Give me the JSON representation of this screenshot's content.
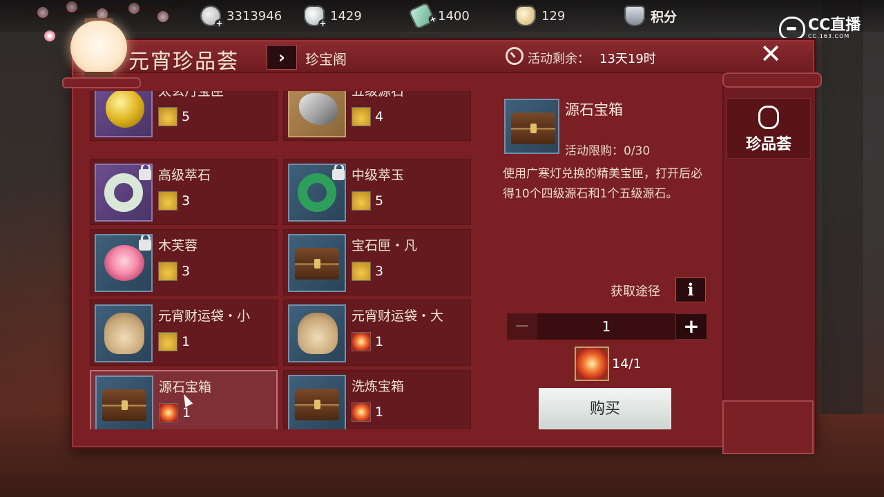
{
  "resources": [
    {
      "icon": "silver-coin-icon",
      "value": "3313946"
    },
    {
      "icon": "silver-ingot-icon",
      "value": "1429"
    },
    {
      "icon": "jade-token-icon",
      "value": "1400"
    },
    {
      "icon": "gold-ingot-icon",
      "value": "129"
    },
    {
      "icon": "points-shield-icon",
      "label": "积分"
    }
  ],
  "watermark": {
    "text": "CC直播",
    "sub": "CC.163.COM"
  },
  "panel": {
    "title": "元宵珍品荟",
    "breadcrumb_arrow": "›",
    "breadcrumb": "珍宝阁",
    "timer_label": "活动剩余：",
    "timer_value": "13天19时",
    "close": "✕"
  },
  "items": [
    {
      "name": "太玄丹宝匣",
      "cost": "5",
      "cost_type": "coin",
      "art": "coin",
      "thumb": "purple",
      "locked": false
    },
    {
      "name": "五级源石",
      "cost": "4",
      "cost_type": "coin",
      "art": "rock",
      "thumb": "gold",
      "locked": false
    },
    {
      "name": "高级萃石",
      "cost": "3",
      "cost_type": "coin",
      "art": "ring-white",
      "thumb": "purple",
      "locked": true
    },
    {
      "name": "中级萃玉",
      "cost": "5",
      "cost_type": "coin",
      "art": "ring-green",
      "thumb": "blue",
      "locked": true
    },
    {
      "name": "木芙蓉",
      "cost": "3",
      "cost_type": "coin",
      "art": "flower",
      "thumb": "blue",
      "locked": true
    },
    {
      "name": "宝石匣・凡",
      "cost": "3",
      "cost_type": "coin",
      "art": "chest",
      "thumb": "blue",
      "locked": false
    },
    {
      "name": "元宵财运袋・小",
      "cost": "1",
      "cost_type": "coin",
      "art": "bag",
      "thumb": "blue",
      "locked": false
    },
    {
      "name": "元宵财运袋・大",
      "cost": "1",
      "cost_type": "lantern",
      "art": "bag",
      "thumb": "blue",
      "locked": false
    },
    {
      "name": "源石宝箱",
      "cost": "1",
      "cost_type": "lantern",
      "art": "chest",
      "thumb": "blue",
      "locked": false,
      "selected": true
    },
    {
      "name": "洗炼宝箱",
      "cost": "1",
      "cost_type": "lantern",
      "art": "chest",
      "thumb": "blue",
      "locked": false
    }
  ],
  "detail": {
    "title": "源石宝箱",
    "limit": "活动限购：0/30",
    "description": "使用广寒灯兑换的精美宝匣，打开后必得10个四级源石和1个五级源石。",
    "acquire_label": "获取途径",
    "info_icon": "i",
    "quantity": "1",
    "minus": "−",
    "plus": "+",
    "price": "14/1",
    "buy_label": "购买"
  },
  "side_tab": {
    "label": "珍品荟",
    "icon": "lantern-icon"
  }
}
